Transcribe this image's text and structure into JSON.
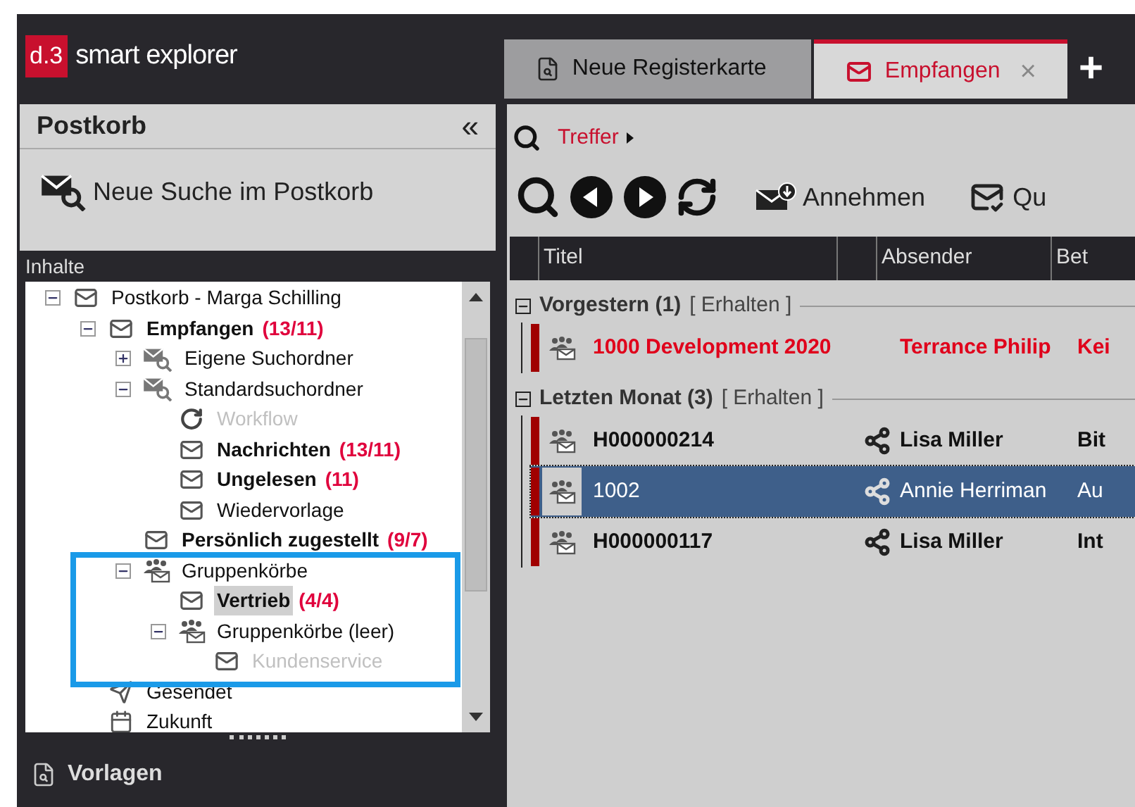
{
  "app": {
    "logo_mark": "d.3",
    "name": "smart explorer"
  },
  "tabs": [
    {
      "label": "Neue Registerkarte",
      "kind": "doc",
      "selected": false
    },
    {
      "label": "Empfangen",
      "kind": "mail",
      "selected": true,
      "close": "×"
    }
  ],
  "new_tab": "+",
  "sidebar": {
    "title": "Postkorb",
    "collapse": "«",
    "action": "Neue Suche im Postkorb",
    "section": "Inhalte",
    "footer": "Vorlagen",
    "tree": [
      {
        "label": "Postkorb - Marga Schilling",
        "kind": "mail",
        "expanded": true,
        "bold": false,
        "disabled": false,
        "selected": false,
        "children": [
          {
            "label": "Empfangen",
            "count": "(13/11)",
            "kind": "mail",
            "expanded": true,
            "bold": true,
            "disabled": false,
            "selected": false,
            "children": [
              {
                "label": "Eigene Suchordner",
                "kind": "searchmail",
                "expanded": false,
                "bold": false,
                "disabled": false,
                "selected": false
              },
              {
                "label": "Standardsuchordner",
                "kind": "searchmail",
                "expanded": true,
                "bold": false,
                "disabled": false,
                "selected": false,
                "children": [
                  {
                    "label": "Workflow",
                    "kind": "workflow",
                    "bold": false,
                    "disabled": true,
                    "selected": false
                  },
                  {
                    "label": "Nachrichten",
                    "count": "(13/11)",
                    "kind": "mail",
                    "bold": true,
                    "disabled": false,
                    "selected": false
                  },
                  {
                    "label": "Ungelesen",
                    "count": "(11)",
                    "kind": "mail",
                    "bold": true,
                    "disabled": false,
                    "selected": false
                  },
                  {
                    "label": "Wiedervorlage",
                    "kind": "mail",
                    "bold": false,
                    "disabled": false,
                    "selected": false
                  }
                ]
              },
              {
                "label": "Persönlich zugestellt",
                "count": "(9/7)",
                "kind": "mail",
                "bold": true,
                "disabled": false,
                "selected": false
              },
              {
                "label": "Gruppenkörbe",
                "kind": "group",
                "expanded": true,
                "bold": false,
                "disabled": false,
                "selected": false,
                "children": [
                  {
                    "label": "Vertrieb",
                    "count": "(4/4)",
                    "kind": "mail",
                    "bold": true,
                    "disabled": false,
                    "selected": true
                  },
                  {
                    "label": "Gruppenkörbe (leer)",
                    "kind": "group",
                    "expanded": true,
                    "bold": false,
                    "disabled": false,
                    "selected": false,
                    "children": [
                      {
                        "label": "Kundenservice",
                        "kind": "mail",
                        "bold": false,
                        "disabled": true,
                        "selected": false
                      }
                    ]
                  }
                ]
              }
            ]
          },
          {
            "label": "Gesendet",
            "kind": "sent",
            "bold": false,
            "disabled": false,
            "selected": false
          },
          {
            "label": "Zukunft",
            "kind": "calendar",
            "bold": false,
            "disabled": false,
            "selected": false
          }
        ]
      }
    ]
  },
  "breadcrumb": {
    "label": "Treffer"
  },
  "toolbar": [
    {
      "kind": "search"
    },
    {
      "kind": "back"
    },
    {
      "kind": "forward"
    },
    {
      "kind": "refresh"
    },
    {
      "kind": "accept",
      "label": "Annehmen"
    },
    {
      "kind": "check",
      "label": "Qu"
    }
  ],
  "table": {
    "columns": [
      "Titel",
      "Absender",
      "Bet"
    ],
    "groups": [
      {
        "title": "Vorgestern (1)",
        "tag": "[ Erhalten ]",
        "rows": [
          {
            "title": "1000  Development 2020",
            "sender": "Terrance Philip",
            "column_5": "Kei",
            "shared": false,
            "red": true,
            "bold": true,
            "selected": false
          }
        ]
      },
      {
        "title": "Letzten Monat (3)",
        "tag": "[ Erhalten ]",
        "rows": [
          {
            "title": "H000000214",
            "sender": "Lisa Miller",
            "column_5": "Bit",
            "shared": true,
            "red": false,
            "bold": true,
            "selected": false
          },
          {
            "title": "1002",
            "sender": "Annie Herriman",
            "column_5": "Au",
            "shared": true,
            "red": false,
            "bold": false,
            "selected": true
          },
          {
            "title": "H000000117",
            "sender": "Lisa Miller",
            "column_5": "Int",
            "shared": true,
            "red": false,
            "bold": true,
            "selected": false
          }
        ]
      }
    ]
  }
}
